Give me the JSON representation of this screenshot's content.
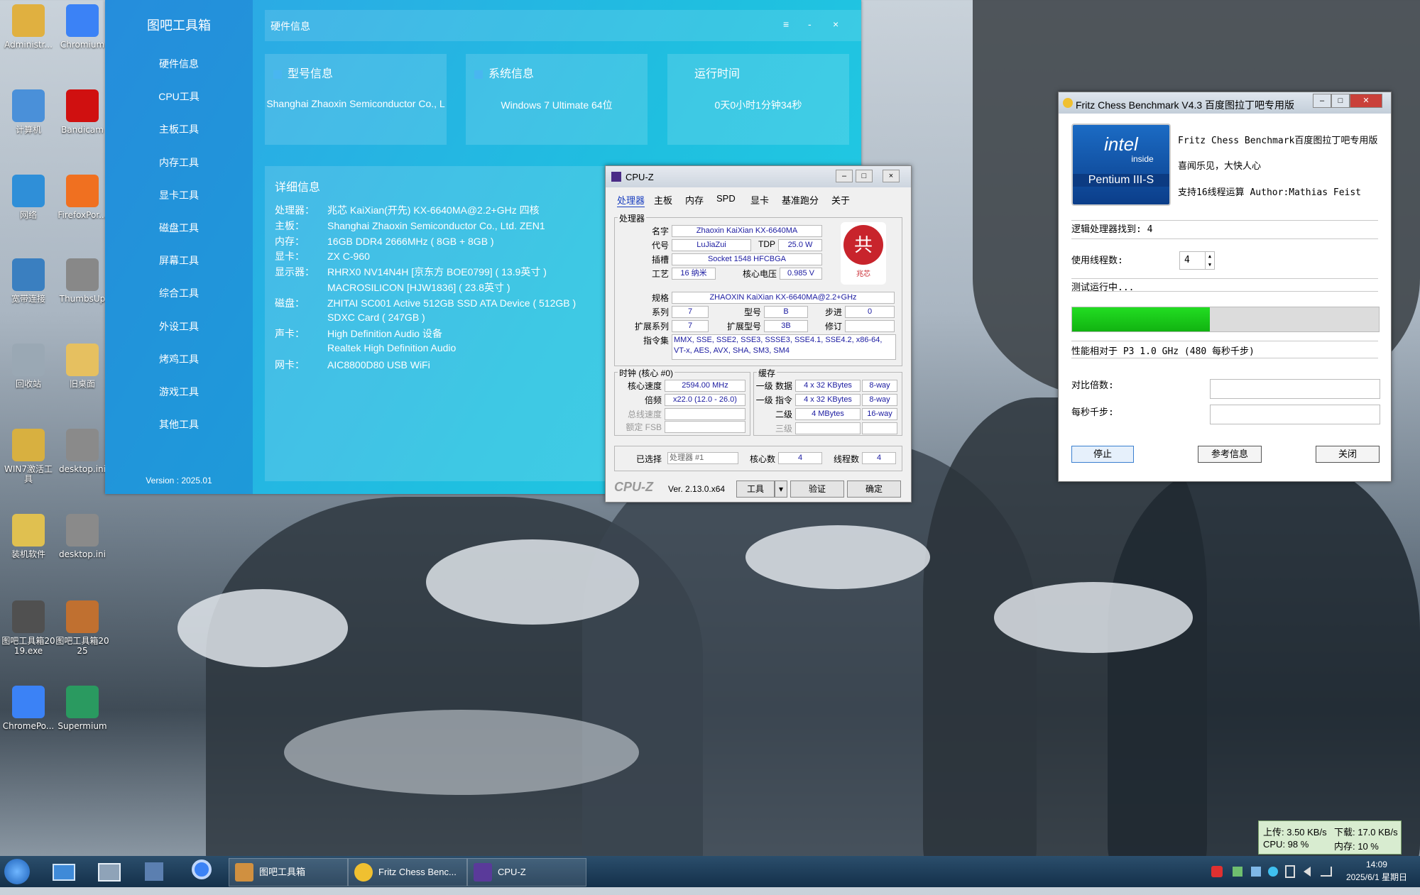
{
  "desktop": {
    "icons": [
      {
        "label": "Administr...",
        "color": "#e0b040"
      },
      {
        "label": "Chromium",
        "color": "#3b82f6"
      },
      {
        "label": "计算机",
        "color": "#4a90d9"
      },
      {
        "label": "Bandicam",
        "color": "#d01010"
      },
      {
        "label": "网络",
        "color": "#2f8fd8"
      },
      {
        "label": "FirefoxPor...",
        "color": "#f07020"
      },
      {
        "label": "宽带连接",
        "color": "#3a7fc0"
      },
      {
        "label": "ThumbsUp",
        "color": "#888888"
      },
      {
        "label": "回收站",
        "color": "#9aa8b4"
      },
      {
        "label": "旧桌面",
        "color": "#e6c060"
      },
      {
        "label": "WIN7激活工具",
        "color": "#d8b040"
      },
      {
        "label": "desktop.ini",
        "color": "#8a8a8a"
      },
      {
        "label": "装机软件",
        "color": "#e0c050"
      },
      {
        "label": "desktop.ini",
        "color": "#8a8a8a"
      },
      {
        "label": "图吧工具箱2019.exe",
        "color": "#505050"
      },
      {
        "label": "图吧工具箱2025",
        "color": "#c07030"
      },
      {
        "label": "ChromePo...",
        "color": "#3b82f6"
      },
      {
        "label": "Supermium",
        "color": "#2a9a60"
      }
    ]
  },
  "tuba": {
    "app_title": "图吧工具箱",
    "nav": [
      "硬件信息",
      "CPU工具",
      "主板工具",
      "内存工具",
      "显卡工具",
      "磁盘工具",
      "屏幕工具",
      "综合工具",
      "外设工具",
      "烤鸡工具",
      "游戏工具",
      "其他工具"
    ],
    "version": "Version : 2025.01",
    "page_title": "硬件信息",
    "window_buttons": {
      "menu": "≡",
      "min": "-",
      "close": "×"
    },
    "cards": [
      {
        "title": "型号信息",
        "value": "Shanghai Zhaoxin Semiconductor Co., L"
      },
      {
        "title": "系统信息",
        "value": "Windows 7 Ultimate 64位"
      },
      {
        "title": "运行时间",
        "value": "0天0小时1分钟34秒"
      }
    ],
    "detail": {
      "title": "详细信息",
      "rows": [
        {
          "k": "处理器：",
          "v": "兆芯 KaiXian(开先) KX-6640MA@2.2+GHz 四核"
        },
        {
          "k": "主板：",
          "v": "Shanghai Zhaoxin Semiconductor Co., Ltd. ZEN1"
        },
        {
          "k": "内存：",
          "v": "16GB DDR4 2666MHz ( 8GB + 8GB )"
        },
        {
          "k": "显卡：",
          "v": "ZX C-960"
        },
        {
          "k": "显示器：",
          "v": "RHRX0 NV14N4H [京东方 BOE0799] ( 13.9英寸 )"
        },
        {
          "k": "",
          "v": "MACROSILICON [HJW1836] ( 23.8英寸 )"
        },
        {
          "k": "磁盘：",
          "v": "ZHITAI SC001 Active 512GB SSD ATA Device ( 512GB )"
        },
        {
          "k": "",
          "v": "SDXC Card ( 247GB )"
        },
        {
          "k": "声卡：",
          "v": "High Definition Audio 设备"
        },
        {
          "k": "",
          "v": "Realtek High Definition Audio"
        },
        {
          "k": "网卡：",
          "v": "AIC8800D80 USB WiFi"
        }
      ]
    }
  },
  "cpuz": {
    "title": "CPU-Z",
    "tabs": [
      "处理器",
      "主板",
      "内存",
      "SPD",
      "显卡",
      "基准跑分",
      "关于"
    ],
    "processor_group": "处理器",
    "labels": {
      "name": "名字",
      "code": "代号",
      "tdp": "TDP",
      "socket": "插槽",
      "tech": "工艺",
      "voltage": "核心电压",
      "spec": "规格",
      "family": "系列",
      "model": "型号",
      "stepping": "步进",
      "ext_family": "扩展系列",
      "ext_model": "扩展型号",
      "revision": "修订",
      "instructions": "指令集"
    },
    "values": {
      "name": "Zhaoxin KaiXian KX-6640MA",
      "code": "LuJiaZui",
      "tdp": "25.0 W",
      "socket": "Socket 1548 HFCBGA",
      "tech": "16 纳米",
      "voltage": "0.985 V",
      "spec": "ZHAOXIN KaiXian KX-6640MA@2.2+GHz",
      "family": "7",
      "model": "B",
      "stepping": "0",
      "ext_family": "7",
      "ext_model": "3B",
      "revision": "",
      "instructions": "MMX, SSE, SSE2, SSE3, SSSE3, SSE4.1, SSE4.2, x86-64, VT-x, AES, AVX, SHA, SM3, SM4"
    },
    "clocks_group": "时钟 (核心 #0)",
    "clocks": {
      "core_speed_l": "核心速度",
      "core_speed": "2594.00 MHz",
      "multiplier_l": "倍频",
      "multiplier": "x22.0 (12.0 - 26.0)",
      "bus_l": "总线速度",
      "fsb_l": "额定 FSB"
    },
    "cache_group": "缓存",
    "cache": [
      {
        "l": "一级 数据",
        "v": "4 x 32 KBytes",
        "w": "8-way"
      },
      {
        "l": "一级 指令",
        "v": "4 x 32 KBytes",
        "w": "8-way"
      },
      {
        "l": "二级",
        "v": "4 MBytes",
        "w": "16-way"
      },
      {
        "l": "三级",
        "v": "",
        "w": ""
      }
    ],
    "bottom": {
      "selected_l": "已选择",
      "selected": "处理器 #1",
      "cores_l": "核心数",
      "cores": "4",
      "threads_l": "线程数",
      "threads": "4"
    },
    "footer": {
      "logo": "CPU-Z",
      "version": "Ver. 2.13.0.x64",
      "tools": "工具",
      "validate": "验证",
      "ok": "确定"
    },
    "brand_mark": "兆芯"
  },
  "fritz": {
    "title": "Fritz Chess Benchmark V4.3  百度图拉丁吧专用版",
    "intel": {
      "brand": "intel",
      "inside": "inside",
      "model": "Pentium III-S"
    },
    "line1": "Fritz Chess Benchmark百度图拉丁吧专用版",
    "line2": "喜闻乐见，大快人心",
    "line3": "支持16线程运算   Author:Mathias Feist",
    "logical": "逻辑处理器找到: 4",
    "threads_label": "使用线程数:",
    "threads_value": "4",
    "status": "测试运行中...",
    "progress": 0.45,
    "progress_color": "#22dd22",
    "relative": "性能相对于 P3 1.0 GHz (480 每秒千步)",
    "ratio_label": "对比倍数:",
    "kn_label": "每秒千步:",
    "buttons": {
      "stop": "停止",
      "ref": "参考信息",
      "close": "关闭"
    }
  },
  "netmon": {
    "up": "上传: 3.50 KB/s",
    "down": "下载: 17.0 KB/s",
    "cpu": "CPU: 98 %",
    "mem": "内存: 10 %"
  },
  "taskbar": {
    "tasks": [
      {
        "label": "图吧工具箱",
        "color": "#d09040"
      },
      {
        "label": "Fritz Chess Benc...",
        "color": "#f0c030"
      },
      {
        "label": "CPU-Z",
        "color": "#5a3a9a"
      }
    ],
    "time": "14:09",
    "date": "2025/6/1 星期日"
  }
}
